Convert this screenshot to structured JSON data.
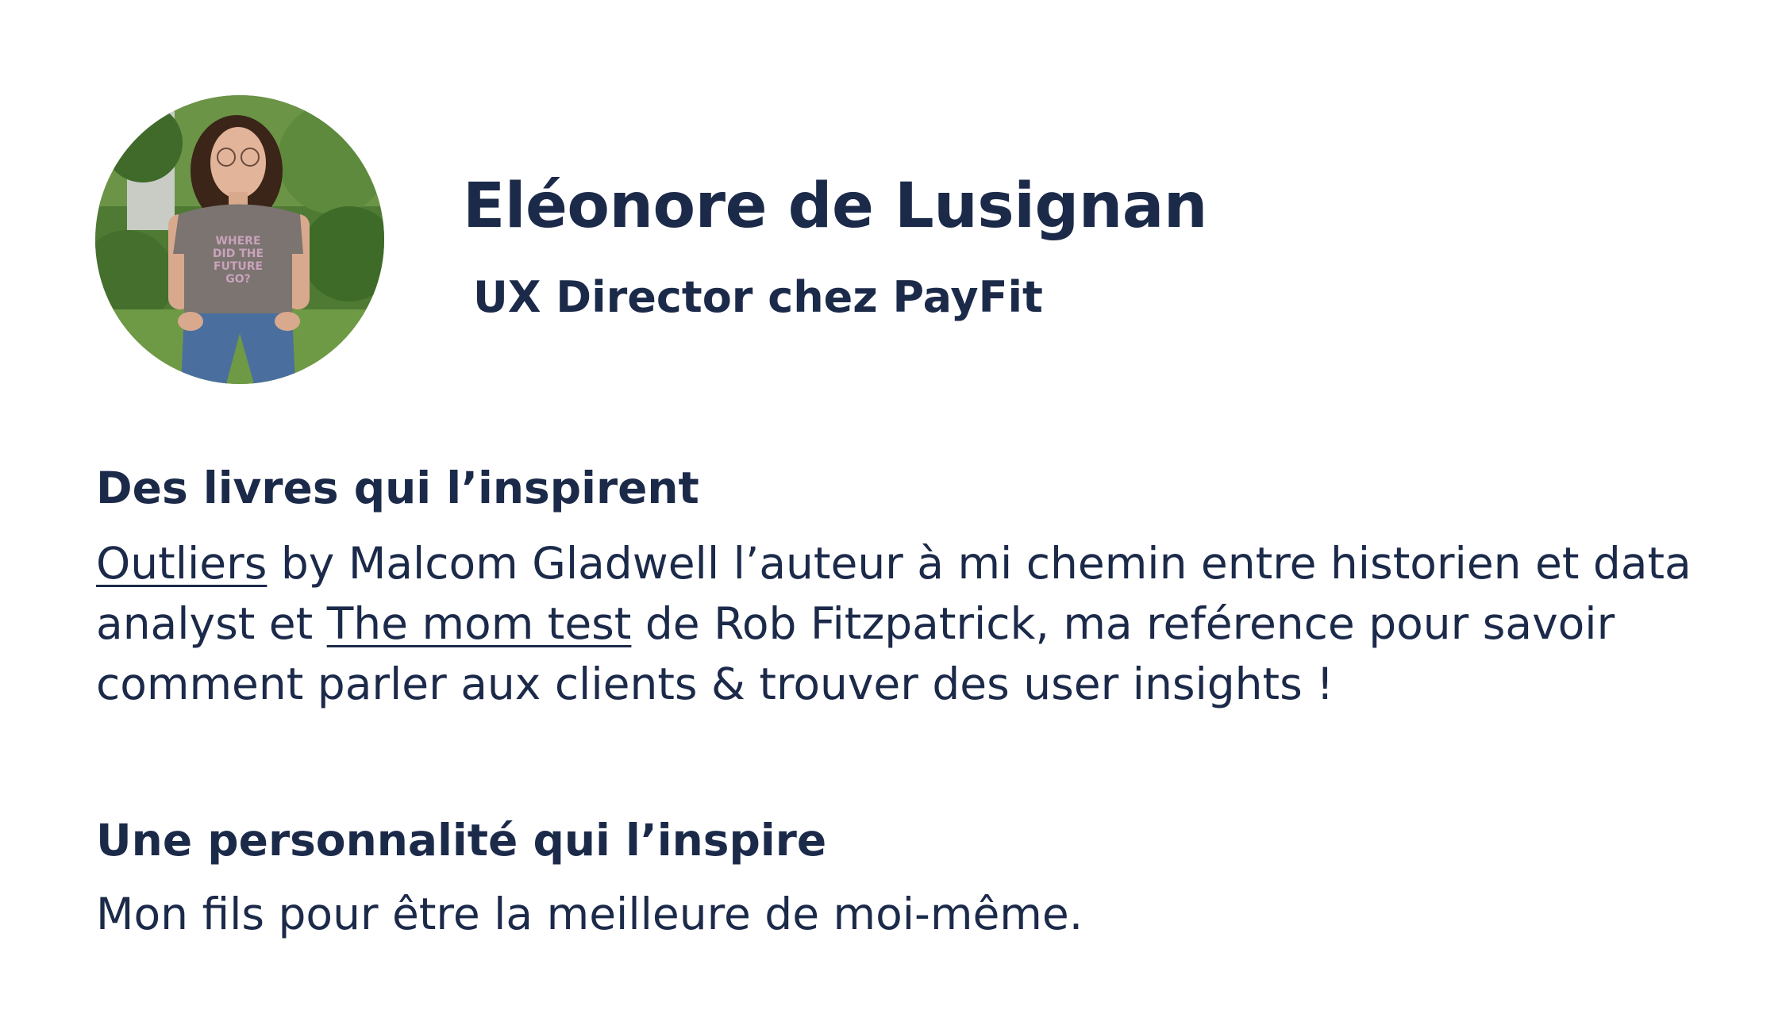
{
  "profile": {
    "name": "Eléonore de Lusignan",
    "role": "UX Director chez PayFit",
    "photo_icon": "profile-photo",
    "tshirt_text": [
      "WHERE",
      "DID THE",
      "FUTURE",
      "GO?"
    ]
  },
  "books": {
    "title": "Des livres qui l’inspirent",
    "book1": "Outliers",
    "text1": " by Malcom Gladwell l’auteur à mi chemin entre historien et data analyst et ",
    "book2": "The mom test",
    "text2": " de Rob Fitzpatrick, ma reférence pour savoir comment parler aux clients & trouver des user insights !"
  },
  "personality": {
    "title": "Une personnalité qui l’inspire",
    "body": "Mon fils pour être la meilleure de moi-même."
  },
  "colors": {
    "text": "#1c2a4a",
    "background": "#ffffff"
  }
}
